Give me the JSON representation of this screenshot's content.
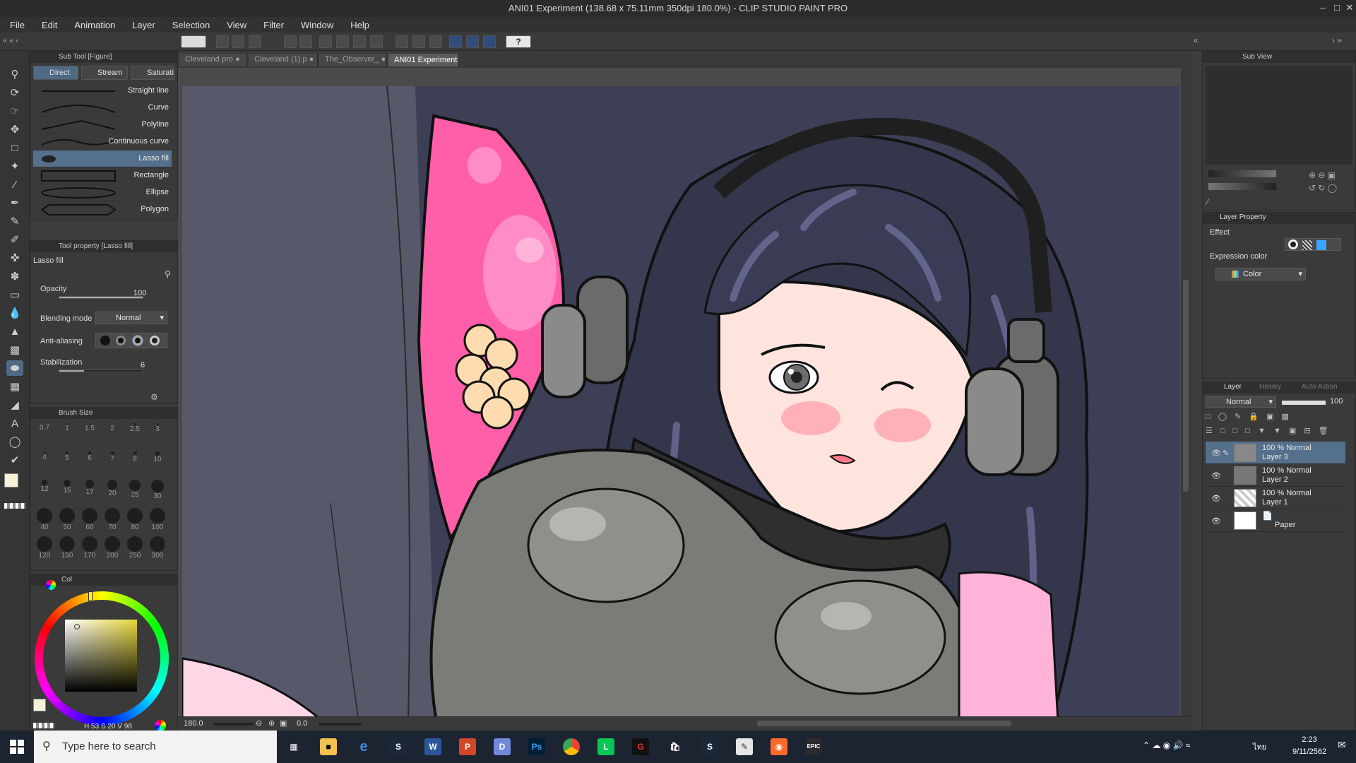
{
  "window": {
    "title": "ANI01 Experiment (138.68 x 75.11mm 350dpi 180.0%) - CLIP STUDIO PAINT PRO"
  },
  "menu": [
    "File",
    "Edit",
    "Animation",
    "Layer",
    "Selection",
    "View",
    "Filter",
    "Window",
    "Help"
  ],
  "doc_tabs": [
    {
      "label": "Cleveland pro"
    },
    {
      "label": "Cleveland (1).p"
    },
    {
      "label": "The_Observer_"
    },
    {
      "label": "ANI01 Experiment"
    }
  ],
  "sub_tool": {
    "header": "Sub Tool [Figure]",
    "tabs": [
      "Direct",
      "Stream",
      "Saturati"
    ],
    "items": [
      "Straight line",
      "Curve",
      "Polyline",
      "Continuous curve",
      "Lasso fill",
      "Rectangle",
      "Ellipse",
      "Polygon"
    ],
    "selected": "Lasso fill"
  },
  "tool_property": {
    "header": "Tool property [Lasso fill]",
    "name": "Lasso fill",
    "opacity_label": "Opacity",
    "opacity_value": "100",
    "blending_label": "Blending mode",
    "blending_value": "Normal",
    "antialias_label": "Anti-aliasing",
    "stabilization_label": "Stabilization",
    "stabilization_value": "6"
  },
  "brush_size": {
    "header": "Brush Size",
    "sizes": [
      "0.7",
      "1",
      "1.5",
      "2",
      "2.5",
      "3",
      "4",
      "5",
      "6",
      "7",
      "8",
      "10",
      "12",
      "15",
      "17",
      "20",
      "25",
      "30",
      "40",
      "50",
      "60",
      "70",
      "80",
      "100",
      "120",
      "150",
      "170",
      "200",
      "250",
      "300"
    ]
  },
  "color": {
    "tab_label": "Col",
    "h_label": "H",
    "h": "53",
    "s_label": "S",
    "s": "20",
    "v_label": "V",
    "v": "98",
    "main_color": "#f6f1d8",
    "square_hue": "#e8d83a"
  },
  "canvas": {
    "zoom": "180.0",
    "rotation": "0.0"
  },
  "sub_view": {
    "label": "Sub View"
  },
  "layer_property": {
    "tab": "Layer Property",
    "effect_label": "Effect",
    "expression_label": "Expression color",
    "expression_value": "Color"
  },
  "layer_panel": {
    "tabs": [
      "Layer",
      "History",
      "Auto Action"
    ],
    "blend": "Normal",
    "opacity": "100",
    "layers": [
      {
        "line1": "100 % Normal",
        "line2": "Layer 3",
        "selected": true
      },
      {
        "line1": "100 % Normal",
        "line2": "Layer 2",
        "selected": false
      },
      {
        "line1": "100 % Normal",
        "line2": "Layer 1",
        "selected": false
      },
      {
        "line1": "",
        "line2": "Paper",
        "selected": false
      }
    ]
  },
  "taskbar": {
    "search_placeholder": "Type here to search",
    "time": "2:23",
    "date": "9/11/2562",
    "lang": "ไทย"
  },
  "colors": {
    "accent": "#55708c",
    "background_canvas": "#3d3f57",
    "pink": "#ff5fa8"
  }
}
